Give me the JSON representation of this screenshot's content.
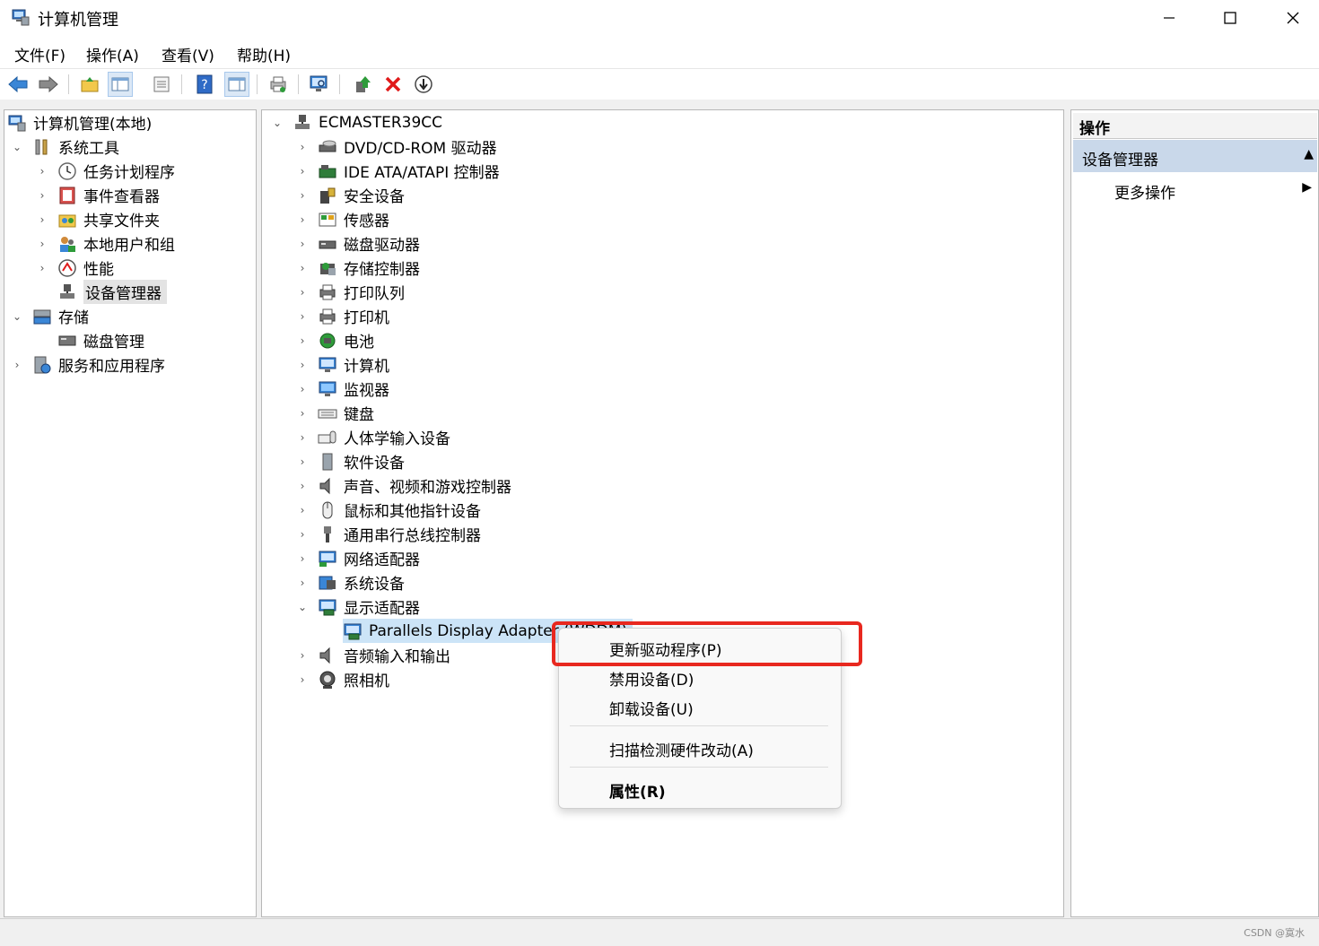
{
  "window": {
    "title": "计算机管理",
    "minimize": "—",
    "maximize": "☐",
    "close": "✕"
  },
  "menu": [
    "文件(F)",
    "操作(A)",
    "查看(V)",
    "帮助(H)"
  ],
  "left_tree": [
    {
      "label": "计算机管理(本地)",
      "icon": "computer-management-icon",
      "level": 0,
      "chevron": ""
    },
    {
      "label": "系统工具",
      "icon": "tools-icon",
      "level": 1,
      "chevron": "⌄"
    },
    {
      "label": "任务计划程序",
      "icon": "clock-icon",
      "level": 2,
      "chevron": "›"
    },
    {
      "label": "事件查看器",
      "icon": "event-viewer-icon",
      "level": 2,
      "chevron": "›"
    },
    {
      "label": "共享文件夹",
      "icon": "shared-folder-icon",
      "level": 2,
      "chevron": "›"
    },
    {
      "label": "本地用户和组",
      "icon": "users-icon",
      "level": 2,
      "chevron": "›"
    },
    {
      "label": "性能",
      "icon": "performance-icon",
      "level": 2,
      "chevron": "›"
    },
    {
      "label": "设备管理器",
      "icon": "device-manager-icon",
      "level": 2,
      "chevron": "",
      "selected": true
    },
    {
      "label": "存储",
      "icon": "storage-icon",
      "level": 1,
      "chevron": "⌄"
    },
    {
      "label": "磁盘管理",
      "icon": "disk-management-icon",
      "level": 2,
      "chevron": ""
    },
    {
      "label": "服务和应用程序",
      "icon": "services-icon",
      "level": 1,
      "chevron": "›"
    }
  ],
  "device_tree": {
    "root": "ECMASTER39CC",
    "categories": [
      {
        "label": "DVD/CD-ROM 驱动器",
        "icon": "dvd-drive-icon"
      },
      {
        "label": "IDE ATA/ATAPI 控制器",
        "icon": "ide-controller-icon"
      },
      {
        "label": "安全设备",
        "icon": "security-device-icon"
      },
      {
        "label": "传感器",
        "icon": "sensor-icon"
      },
      {
        "label": "磁盘驱动器",
        "icon": "disk-drive-icon"
      },
      {
        "label": "存储控制器",
        "icon": "storage-controller-icon"
      },
      {
        "label": "打印队列",
        "icon": "print-queue-icon"
      },
      {
        "label": "打印机",
        "icon": "printer-icon"
      },
      {
        "label": "电池",
        "icon": "battery-icon"
      },
      {
        "label": "计算机",
        "icon": "computer-icon"
      },
      {
        "label": "监视器",
        "icon": "monitor-icon"
      },
      {
        "label": "键盘",
        "icon": "keyboard-icon"
      },
      {
        "label": "人体学输入设备",
        "icon": "hid-icon"
      },
      {
        "label": "软件设备",
        "icon": "software-device-icon"
      },
      {
        "label": "声音、视频和游戏控制器",
        "icon": "sound-icon"
      },
      {
        "label": "鼠标和其他指针设备",
        "icon": "mouse-icon"
      },
      {
        "label": "通用串行总线控制器",
        "icon": "usb-icon"
      },
      {
        "label": "网络适配器",
        "icon": "network-adapter-icon"
      },
      {
        "label": "系统设备",
        "icon": "system-device-icon"
      },
      {
        "label": "显示适配器",
        "icon": "display-adapter-icon",
        "expanded": true
      },
      {
        "label": "Parallels Display Adapter (WDDM)",
        "icon": "display-adapter-icon",
        "child": true
      },
      {
        "label": "音频输入和输出",
        "icon": "audio-io-icon"
      },
      {
        "label": "照相机",
        "icon": "camera-icon"
      }
    ]
  },
  "actions": {
    "header": "操作",
    "section": "设备管理器",
    "more": "更多操作",
    "collapse_glyph": "▲",
    "more_glyph": "▶"
  },
  "context_menu": [
    {
      "label": "更新驱动程序(P)",
      "bold": false
    },
    {
      "label": "禁用设备(D)",
      "bold": false
    },
    {
      "label": "卸载设备(U)",
      "bold": false
    },
    {
      "label": "扫描检测硬件改动(A)",
      "bold": false
    },
    {
      "label": "属性(R)",
      "bold": true
    }
  ],
  "watermark": "CSDN @寞水",
  "colors": {
    "highlight": "#e8281f",
    "selection": "#c9d8ea",
    "accent": "#0067c0"
  }
}
